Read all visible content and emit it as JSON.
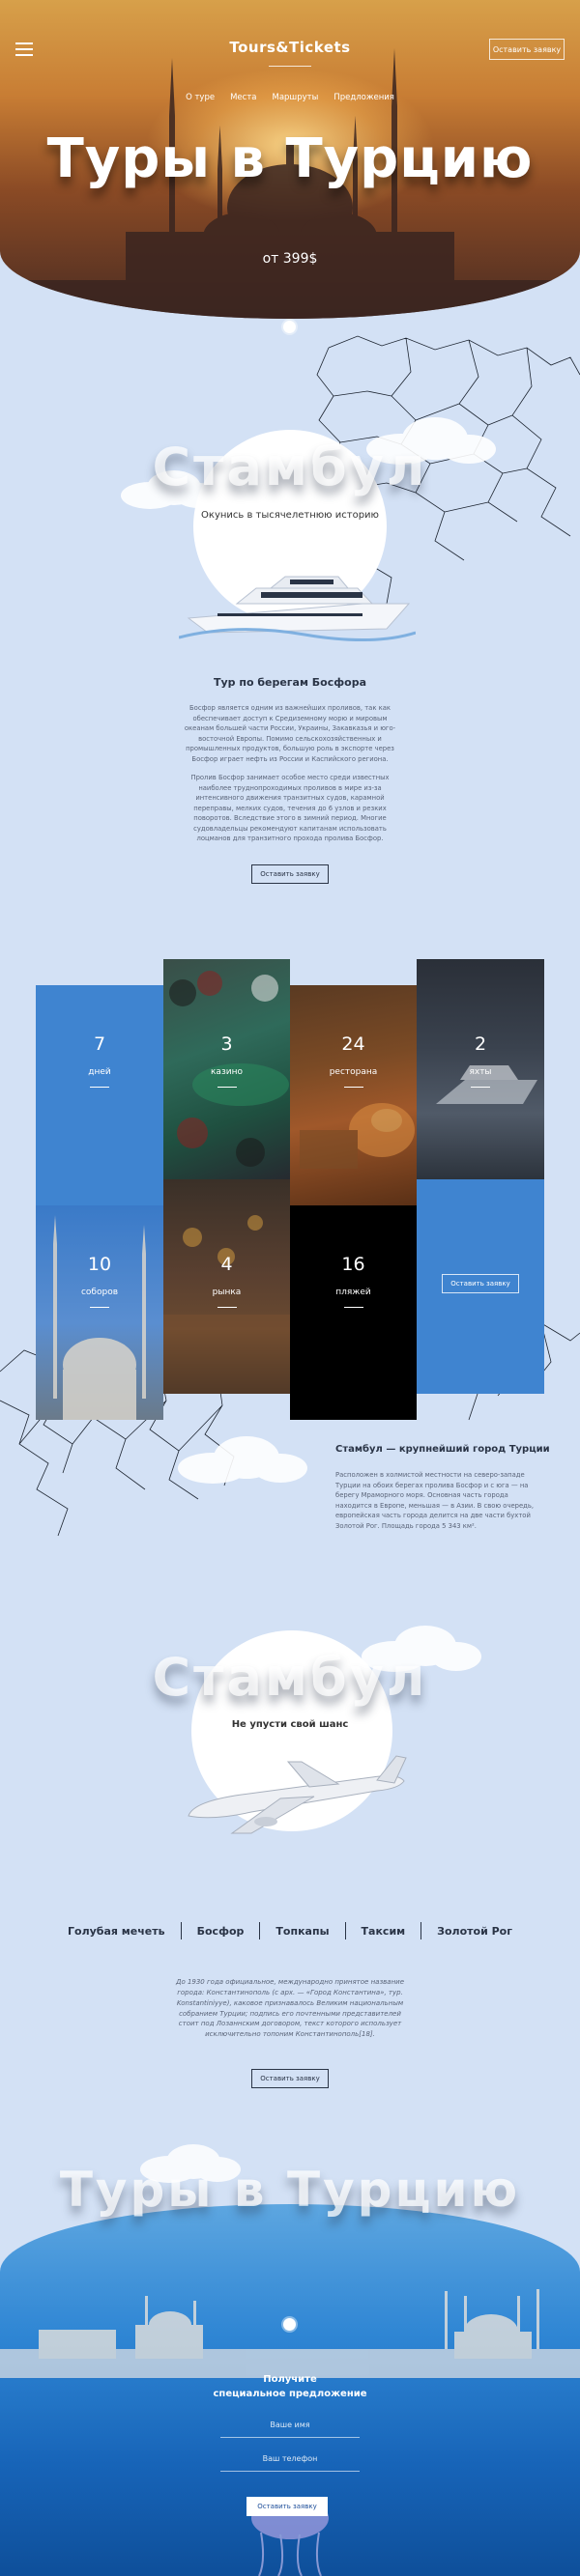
{
  "header": {
    "logo": "Tours&Tickets",
    "cta": "Оставить заявку",
    "nav": [
      "О туре",
      "Места",
      "Маршруты",
      "Предложения"
    ]
  },
  "hero": {
    "title": "Туры в Турцию",
    "price": "от 399$"
  },
  "city_section": {
    "ghost_title": "Стамбул",
    "caption": "Окунись в тысячелетнюю историю",
    "tour_title": "Тур по берегам Босфора",
    "paragraph_1": "Босфор является одним из важнейших проливов, так как обеспечивает доступ к Средиземному морю и мировым океанам большей части России, Украины, Закавказья и юго-восточной Европы. Помимо сельскохозяйственных и промышленных продуктов, большую роль в экспорте через Босфор играет нефть из России и Каспийского региона.",
    "paragraph_2": "Пролив Босфор занимает особое место среди известных наиболее труднопроходимых проливов в мире из-за интенсивного движения транзитных судов, карамной переправы, мелких судов, течения до 6 узлов и резких поворотов. Вследствие этого в зимний период. Многие судовладельцы рекомендуют капитанам использовать лоцманов для транзитного прохода пролива Босфор.",
    "cta": "Оставить заявку"
  },
  "stats": [
    {
      "num": "7",
      "label": "дней"
    },
    {
      "num": "3",
      "label": "казино"
    },
    {
      "num": "24",
      "label": "ресторана"
    },
    {
      "num": "2",
      "label": "яхты"
    },
    {
      "num": "10",
      "label": "соборов"
    },
    {
      "num": "4",
      "label": "рынка"
    },
    {
      "num": "16",
      "label": "пляжей"
    }
  ],
  "stats_cta": "Оставить заявку",
  "city_info": {
    "title": "Стамбул — крупнейший город Турции",
    "text": "Расположен в холмистой местности на северо-западе Турции на обоих берегах пролива Босфор и с юга — на берегу Мраморного моря. Основная часть города находится в Европе, меньшая — в Азии. В свою очередь, европейская часть города делится на две части бухтой Золотой Рог. Площадь города 5 343 км²."
  },
  "plane_section": {
    "ghost_title": "Стамбул",
    "caption": "Не упусти свой шанс"
  },
  "tabs": [
    "Голубая мечеть",
    "Босфор",
    "Топкапы",
    "Таксим",
    "Золотой Рог"
  ],
  "tabs_text": "До 1930 года официальное, международно принятое название города: Константинополь (с арх. — «Город Константина», тур. Konstantiniyye), каковое признавалось Великим национальным собранием Турции; подпись его почтенными представителей стоит под Лозаннским договором, текст которого использует исключительно топоним Константинополь[18].",
  "tabs_cta": "Оставить заявку",
  "footer": {
    "ghost_title": "Туры в Турцию",
    "form_title_1": "Получите",
    "form_title_2": "специальное предложение",
    "name_placeholder": "Ваше имя",
    "phone_placeholder": "Ваш телефон",
    "submit": "Оставить заявку"
  }
}
